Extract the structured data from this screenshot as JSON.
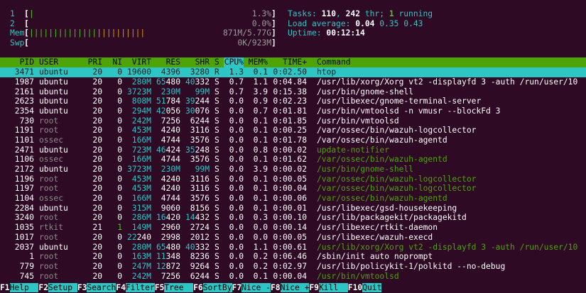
{
  "meters": {
    "cpu1": {
      "label": "1",
      "bar": "|",
      "value": "1.3%"
    },
    "cpu2": {
      "label": "2",
      "bar": "",
      "value": "0.0%"
    },
    "mem": {
      "label": "Mem",
      "bar_green": "||||||||||||||",
      "bar_orange": "||||||||||",
      "value": "871M/5.77G"
    },
    "swp": {
      "label": "Swp",
      "bar": "",
      "value": "0K/923M"
    }
  },
  "info": {
    "tasks_label": "Tasks: ",
    "tasks": "110",
    "sep1": ", ",
    "threads": "242",
    "thr_label": " thr; ",
    "running": "1",
    "running_label": " running",
    "load_label": "Load average: ",
    "load1": "0.04",
    "load5": "0.35",
    "load15": "0.43",
    "uptime_label": "Uptime: ",
    "uptime": "00:12:14"
  },
  "columns": [
    "PID",
    "USER",
    "PRI",
    "NI",
    "VIRT",
    "RES",
    "SHR",
    "S",
    "CPU%",
    "MEM%",
    "TIME+",
    "Command"
  ],
  "processes": [
    {
      "pid": "3471",
      "user": "ubuntu",
      "pri": "20",
      "ni": "0",
      "virt": "19600",
      "res": "4396",
      "shr": "3280",
      "s": "R",
      "cpu": "1.3",
      "mem": "0.1",
      "time": "0:02.50",
      "cmd": "htop",
      "selected": true
    },
    {
      "pid": "1987",
      "user": "ubuntu",
      "pri": "20",
      "ni": "0",
      "virt": "280M",
      "res": "65480",
      "shr": "40332",
      "s": "S",
      "cpu": "0.7",
      "mem": "1.1",
      "time": "0:04.84",
      "cmd": "/usr/lib/xorg/Xorg vt2 -displayfd 3 -auth /run/user/10"
    },
    {
      "pid": "2161",
      "user": "ubuntu",
      "pri": "20",
      "ni": "0",
      "virt": "3723M",
      "res": "230M",
      "shr": "99M",
      "s": "S",
      "cpu": "0.7",
      "mem": "3.9",
      "time": "0:15.38",
      "cmd": "/usr/bin/gnome-shell"
    },
    {
      "pid": "2623",
      "user": "ubuntu",
      "pri": "20",
      "ni": "0",
      "virt": "808M",
      "res": "51784",
      "shr": "39244",
      "s": "S",
      "cpu": "0.0",
      "mem": "0.9",
      "time": "0:02.23",
      "cmd": "/usr/libexec/gnome-terminal-server"
    },
    {
      "pid": "2354",
      "user": "ubuntu",
      "pri": "20",
      "ni": "0",
      "virt": "294M",
      "res": "42056",
      "shr": "30076",
      "s": "S",
      "cpu": "0.0",
      "mem": "0.7",
      "time": "0:01.81",
      "cmd": "/usr/bin/vmtoolsd -n vmusr --blockFd 3"
    },
    {
      "pid": "730",
      "user": "root",
      "pri": "20",
      "ni": "0",
      "virt": "242M",
      "res": "7256",
      "shr": "6244",
      "s": "S",
      "cpu": "0.0",
      "mem": "0.1",
      "time": "0:01.85",
      "cmd": "/usr/bin/vmtoolsd"
    },
    {
      "pid": "1191",
      "user": "root",
      "pri": "20",
      "ni": "0",
      "virt": "453M",
      "res": "4240",
      "shr": "3116",
      "s": "S",
      "cpu": "0.0",
      "mem": "0.1",
      "time": "0:00.25",
      "cmd": "/var/ossec/bin/wazuh-logcollector"
    },
    {
      "pid": "1101",
      "user": "ossec",
      "pri": "20",
      "ni": "0",
      "virt": "166M",
      "res": "4744",
      "shr": "3576",
      "s": "S",
      "cpu": "0.0",
      "mem": "0.1",
      "time": "0:01.78",
      "cmd": "/var/ossec/bin/wazuh-agentd"
    },
    {
      "pid": "2471",
      "user": "ubuntu",
      "pri": "20",
      "ni": "0",
      "virt": "723M",
      "res": "46424",
      "shr": "35248",
      "s": "S",
      "cpu": "0.0",
      "mem": "0.8",
      "time": "0:00.02",
      "cmd": "update-notifier",
      "thread": true
    },
    {
      "pid": "1106",
      "user": "ossec",
      "pri": "20",
      "ni": "0",
      "virt": "166M",
      "res": "4744",
      "shr": "3576",
      "s": "S",
      "cpu": "0.0",
      "mem": "0.1",
      "time": "0:01.62",
      "cmd": "/var/ossec/bin/wazuh-agentd",
      "thread": true
    },
    {
      "pid": "2172",
      "user": "ubuntu",
      "pri": "20",
      "ni": "0",
      "virt": "3723M",
      "res": "230M",
      "shr": "99M",
      "s": "S",
      "cpu": "0.0",
      "mem": "3.9",
      "time": "0:00.02",
      "cmd": "/usr/bin/gnome-shell",
      "thread": true
    },
    {
      "pid": "1196",
      "user": "root",
      "pri": "20",
      "ni": "0",
      "virt": "453M",
      "res": "4240",
      "shr": "3116",
      "s": "S",
      "cpu": "0.0",
      "mem": "0.1",
      "time": "0:00.05",
      "cmd": "/var/ossec/bin/wazuh-logcollector",
      "thread": true
    },
    {
      "pid": "1197",
      "user": "root",
      "pri": "20",
      "ni": "0",
      "virt": "453M",
      "res": "4240",
      "shr": "3116",
      "s": "S",
      "cpu": "0.0",
      "mem": "0.1",
      "time": "0:00.04",
      "cmd": "/var/ossec/bin/wazuh-logcollector",
      "thread": true
    },
    {
      "pid": "1104",
      "user": "ossec",
      "pri": "20",
      "ni": "0",
      "virt": "166M",
      "res": "4744",
      "shr": "3576",
      "s": "S",
      "cpu": "0.0",
      "mem": "0.1",
      "time": "0:00.06",
      "cmd": "/var/ossec/bin/wazuh-agentd",
      "thread": true
    },
    {
      "pid": "2284",
      "user": "ubuntu",
      "pri": "20",
      "ni": "0",
      "virt": "315M",
      "res": "9060",
      "shr": "8156",
      "s": "S",
      "cpu": "0.0",
      "mem": "0.1",
      "time": "0:00.01",
      "cmd": "/usr/libexec/gsd-housekeeping"
    },
    {
      "pid": "3240",
      "user": "root",
      "pri": "20",
      "ni": "0",
      "virt": "286M",
      "res": "16420",
      "shr": "14432",
      "s": "S",
      "cpu": "0.0",
      "mem": "0.3",
      "time": "0:00.10",
      "cmd": "/usr/lib/packagekit/packagekitd"
    },
    {
      "pid": "1035",
      "user": "rtkit",
      "pri": "21",
      "ni": "1",
      "virt": "149M",
      "res": "2960",
      "shr": "2724",
      "s": "S",
      "cpu": "0.0",
      "mem": "0.0",
      "time": "0:00.14",
      "cmd": "/usr/libexec/rtkit-daemon",
      "ni_pos": true
    },
    {
      "pid": "1017",
      "user": "root",
      "pri": "20",
      "ni": "0",
      "virt": "22240",
      "res": "2998",
      "shr": "2012",
      "s": "S",
      "cpu": "0.0",
      "mem": "0.0",
      "time": "0:00.05",
      "cmd": "/usr/libexec/wazuh-execd"
    },
    {
      "pid": "2037",
      "user": "ubuntu",
      "pri": "20",
      "ni": "0",
      "virt": "280M",
      "res": "65480",
      "shr": "40332",
      "s": "S",
      "cpu": "0.0",
      "mem": "1.1",
      "time": "0:00.61",
      "cmd": "/usr/lib/xorg/Xorg vt2 -displayfd 3 -auth /run/user/10",
      "thread": true
    },
    {
      "pid": "1",
      "user": "root",
      "pri": "20",
      "ni": "0",
      "virt": "163M",
      "res": "11348",
      "shr": "8236",
      "s": "S",
      "cpu": "0.0",
      "mem": "0.2",
      "time": "0:06.46",
      "cmd": "/sbin/init auto noprompt"
    },
    {
      "pid": "779",
      "user": "root",
      "pri": "20",
      "ni": "0",
      "virt": "247M",
      "res": "12872",
      "shr": "9264",
      "s": "S",
      "cpu": "0.0",
      "mem": "0.2",
      "time": "0:02.97",
      "cmd": "/usr/lib/policykit-1/polkitd --no-debug"
    },
    {
      "pid": "745",
      "user": "root",
      "pri": "20",
      "ni": "0",
      "virt": "242M",
      "res": "7256",
      "shr": "6244",
      "s": "S",
      "cpu": "0.0",
      "mem": "0.1",
      "time": "0:00.04",
      "cmd": "/usr/bin/vmtoolsd",
      "thread": true
    }
  ],
  "footer": [
    {
      "key": "F1",
      "label": "Help  "
    },
    {
      "key": "F2",
      "label": "Setup "
    },
    {
      "key": "F3",
      "label": "Search"
    },
    {
      "key": "F4",
      "label": "Filter"
    },
    {
      "key": "F5",
      "label": "Tree  "
    },
    {
      "key": "F6",
      "label": "SortBy"
    },
    {
      "key": "F7",
      "label": "Nice -"
    },
    {
      "key": "F8",
      "label": "Nice +"
    },
    {
      "key": "F9",
      "label": "Kill  "
    },
    {
      "key": "F10",
      "label": "Quit"
    }
  ],
  "colors": {
    "background": "#2f0a25",
    "header_bg": "#4ea406",
    "selection_bg": "#2ec5c5",
    "green": "#4ec61b",
    "cyan": "#2ec5c5"
  }
}
